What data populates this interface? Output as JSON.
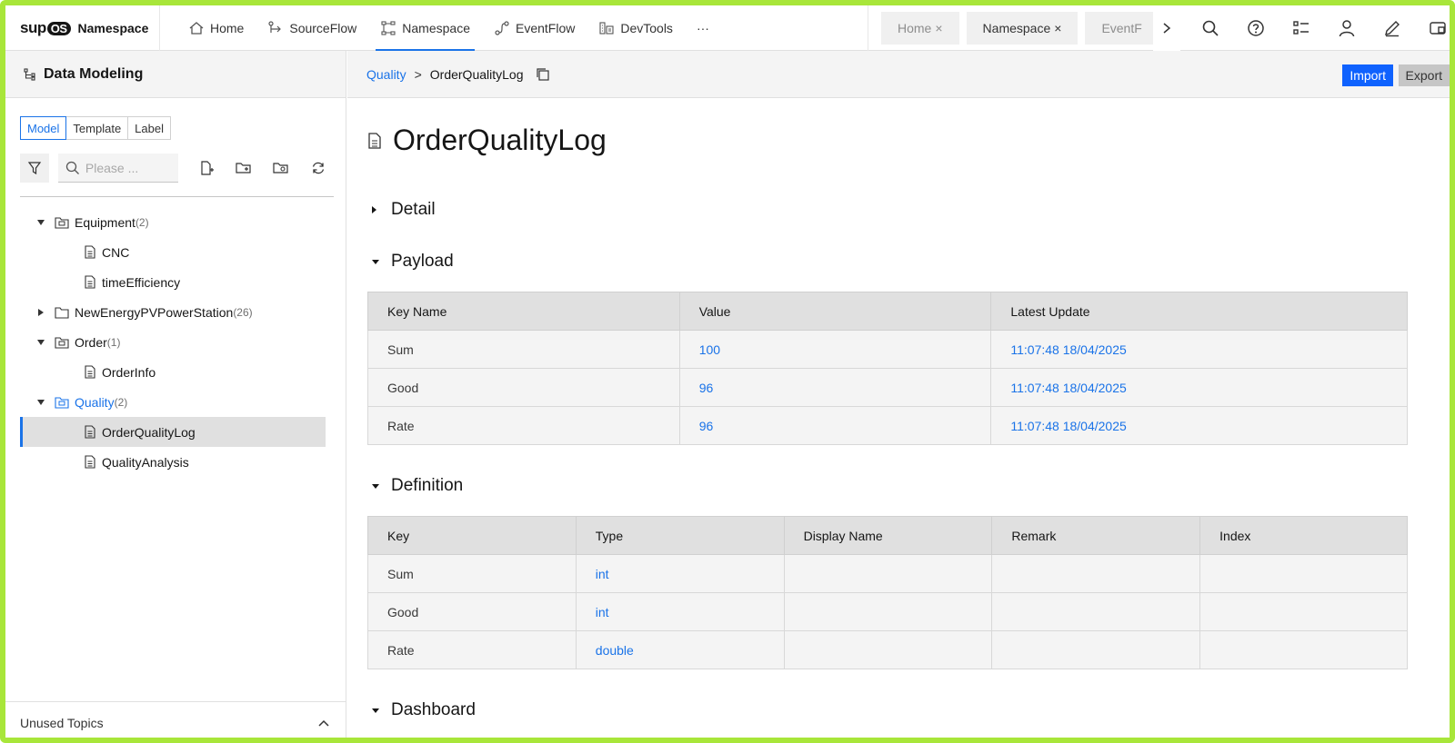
{
  "app": {
    "logo_text": "sup",
    "logo_badge": "OS",
    "section_name": "Namespace"
  },
  "nav": [
    {
      "label": "Home",
      "icon": "home-icon"
    },
    {
      "label": "SourceFlow",
      "icon": "source-flow-icon"
    },
    {
      "label": "Namespace",
      "icon": "namespace-icon",
      "active": true
    },
    {
      "label": "EventFlow",
      "icon": "event-flow-icon"
    },
    {
      "label": "DevTools",
      "icon": "dev-tools-icon"
    }
  ],
  "nav_more": "···",
  "open_tabs": [
    {
      "label": "Home",
      "close": "×"
    },
    {
      "label": "Namespace",
      "close": "×"
    },
    {
      "label": "EventF",
      "close": ""
    }
  ],
  "toolbar_icons": [
    "search-icon",
    "help-icon",
    "task-list-icon",
    "user-icon",
    "edit-icon",
    "window-icon"
  ],
  "left_panel": {
    "title": "Data Modeling",
    "tabs": [
      "Model",
      "Template",
      "Label"
    ],
    "selected_tab": "Model",
    "search_placeholder": "Please ...",
    "tree": [
      {
        "label": "Equipment",
        "count": "(2)",
        "level": 0,
        "expanded": true,
        "type": "folder-model"
      },
      {
        "label": "CNC",
        "count": "",
        "level": 1,
        "type": "file"
      },
      {
        "label": "timeEfficiency",
        "count": "",
        "level": 1,
        "type": "file"
      },
      {
        "label": "NewEnergyPVPowerStation",
        "count": "(26)",
        "level": 0,
        "expanded": false,
        "type": "folder"
      },
      {
        "label": "Order",
        "count": "(1)",
        "level": 0,
        "expanded": true,
        "type": "folder-model"
      },
      {
        "label": "OrderInfo",
        "count": "",
        "level": 1,
        "type": "file"
      },
      {
        "label": "Quality",
        "count": "(2)",
        "level": 0,
        "expanded": true,
        "type": "folder-model",
        "highlight": true
      },
      {
        "label": "OrderQualityLog",
        "count": "",
        "level": 1,
        "type": "file",
        "selected": true
      },
      {
        "label": "QualityAnalysis",
        "count": "",
        "level": 1,
        "type": "file"
      }
    ],
    "footer_label": "Unused Topics"
  },
  "content": {
    "breadcrumb_parent": "Quality",
    "breadcrumb_sep": ">",
    "breadcrumb_current": "OrderQualityLog",
    "import_label": "Import",
    "export_label": "Export",
    "title": "OrderQualityLog",
    "sections": {
      "detail": "Detail",
      "payload": "Payload",
      "definition": "Definition",
      "dashboard": "Dashboard"
    },
    "payload_table": {
      "headers": [
        "Key Name",
        "Value",
        "Latest Update"
      ],
      "rows": [
        [
          "Sum",
          "100",
          "11:07:48 18/04/2025"
        ],
        [
          "Good",
          "96",
          "11:07:48 18/04/2025"
        ],
        [
          "Rate",
          "96",
          "11:07:48 18/04/2025"
        ]
      ]
    },
    "definition_table": {
      "headers": [
        "Key",
        "Type",
        "Display Name",
        "Remark",
        "Index"
      ],
      "rows": [
        [
          "Sum",
          "int",
          "",
          "",
          ""
        ],
        [
          "Good",
          "int",
          "",
          "",
          ""
        ],
        [
          "Rate",
          "double",
          "",
          "",
          ""
        ]
      ]
    }
  },
  "colors": {
    "accent": "#1a73e8",
    "frame": "#a8e63a",
    "import_button": "#0f62fe"
  }
}
